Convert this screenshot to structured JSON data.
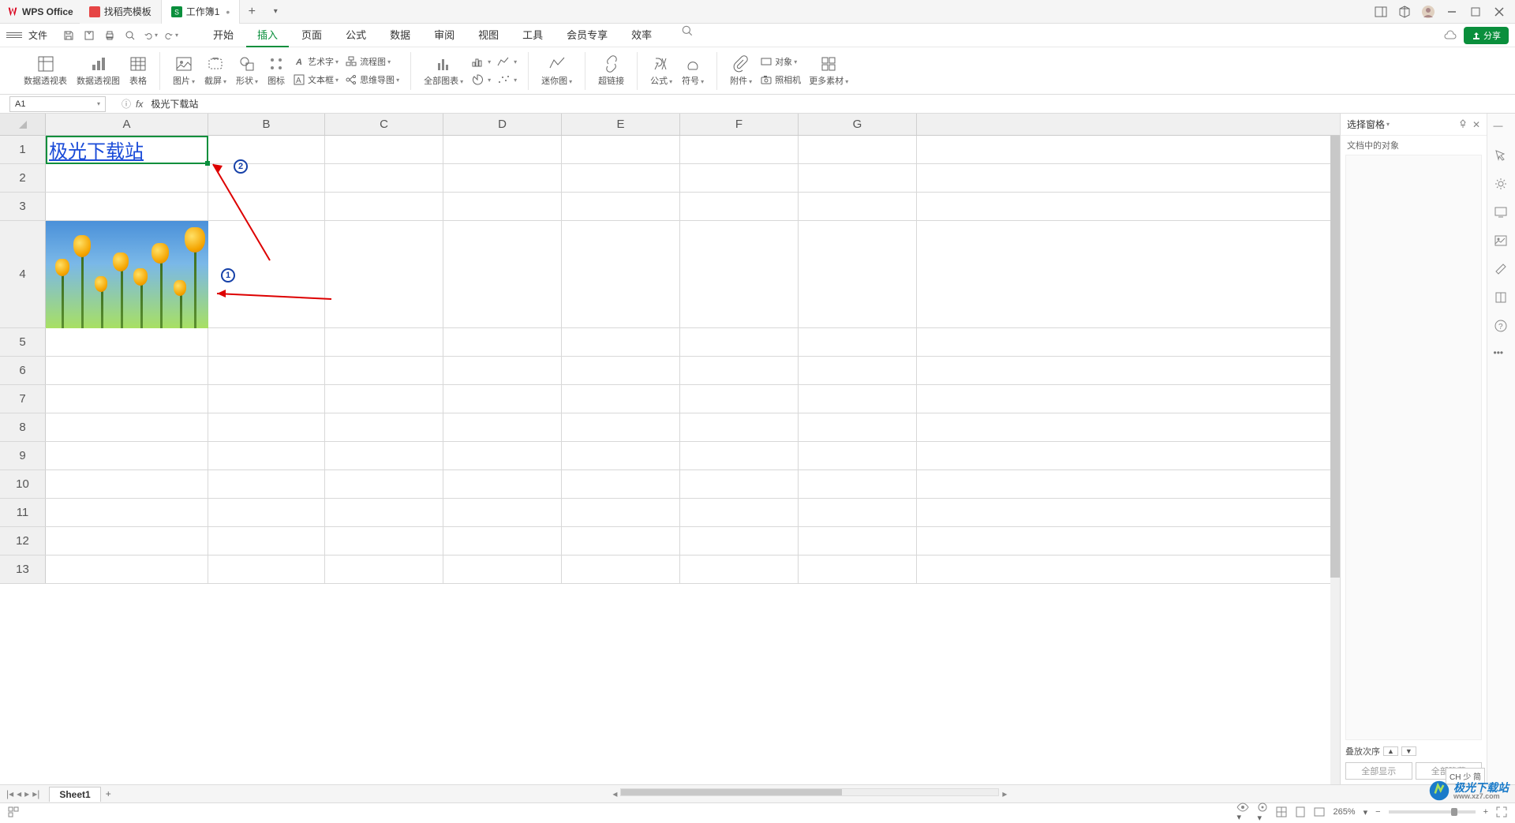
{
  "app": {
    "name": "WPS Office"
  },
  "tabs": [
    {
      "label": "找稻壳模板",
      "active": false
    },
    {
      "label": "工作簿1",
      "active": true
    }
  ],
  "menu": {
    "file": "文件",
    "items": [
      "开始",
      "插入",
      "页面",
      "公式",
      "数据",
      "审阅",
      "视图",
      "工具",
      "会员专享",
      "效率"
    ],
    "active": "插入",
    "share": "分享"
  },
  "ribbon": {
    "pivot_table": "数据透视表",
    "pivot_chart": "数据透视图",
    "table": "表格",
    "picture": "图片",
    "screenshot": "截屏",
    "shapes": "形状",
    "icons": "图标",
    "wordart": "艺术字",
    "textbox": "文本框",
    "flowchart": "流程图",
    "mindmap": "思维导图",
    "all_charts": "全部图表",
    "sparkline": "迷你图",
    "hyperlink": "超链接",
    "formula": "公式",
    "symbol": "符号",
    "attachment": "附件",
    "object": "对象",
    "camera": "照相机",
    "more": "更多素材"
  },
  "name_box": "A1",
  "formula": "极光下载站",
  "cell_A1": "极光下载站",
  "columns": [
    "A",
    "B",
    "C",
    "D",
    "E",
    "F",
    "G"
  ],
  "rows": [
    1,
    2,
    3,
    4,
    5,
    6,
    7,
    8,
    9,
    10,
    11,
    12,
    13
  ],
  "panel": {
    "title": "选择窗格",
    "subtitle": "文档中的对象",
    "order": "叠放次序",
    "show_all": "全部显示",
    "hide_all": "全部隐藏"
  },
  "sheets": {
    "active": "Sheet1"
  },
  "status": {
    "zoom": "265%"
  },
  "ime": "CH 少 简",
  "annotations": {
    "n1": "1",
    "n2": "2"
  },
  "watermark": {
    "text": "极光下载站",
    "url": "www.xz7.com"
  }
}
